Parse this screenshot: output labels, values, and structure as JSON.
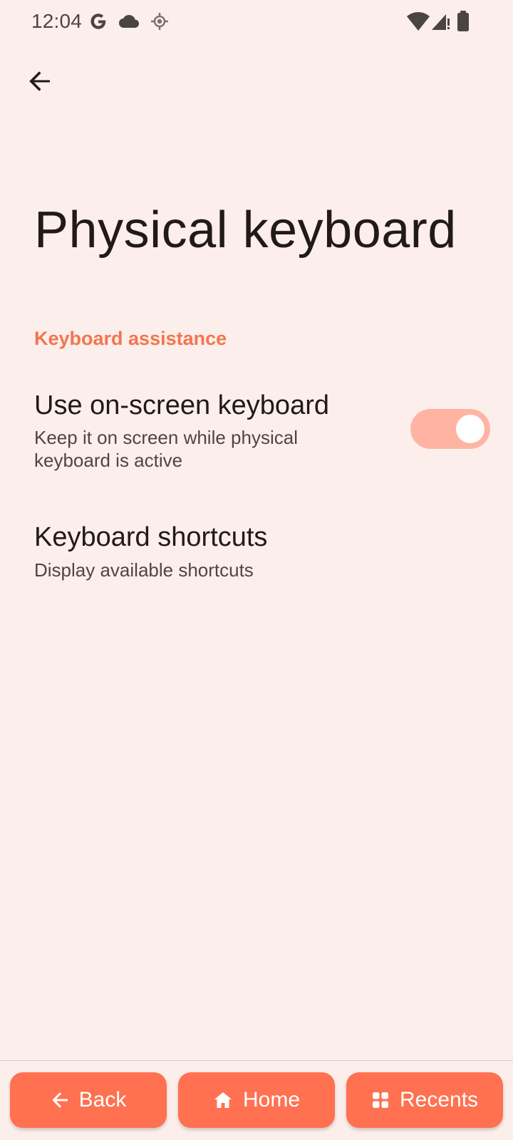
{
  "status_bar": {
    "time": "12:04",
    "icons": [
      "google-icon",
      "cloud-icon",
      "location-icon",
      "wifi-icon",
      "signal-icon",
      "battery-icon"
    ]
  },
  "header": {
    "back_icon": "arrow-back-icon"
  },
  "page": {
    "title": "Physical keyboard",
    "section_header": "Keyboard assistance"
  },
  "preferences": [
    {
      "title": "Use on-screen keyboard",
      "summary": "Keep it on screen while physical keyboard is active",
      "toggle_on": true
    },
    {
      "title": "Keyboard shortcuts",
      "summary": "Display available shortcuts"
    }
  ],
  "nav": {
    "back_label": "Back",
    "home_label": "Home",
    "recents_label": "Recents"
  },
  "colors": {
    "background": "#FCEEEB",
    "accent": "#F2764F",
    "toggle_track": "#FFB4A3",
    "nav_button": "#FF7150"
  }
}
